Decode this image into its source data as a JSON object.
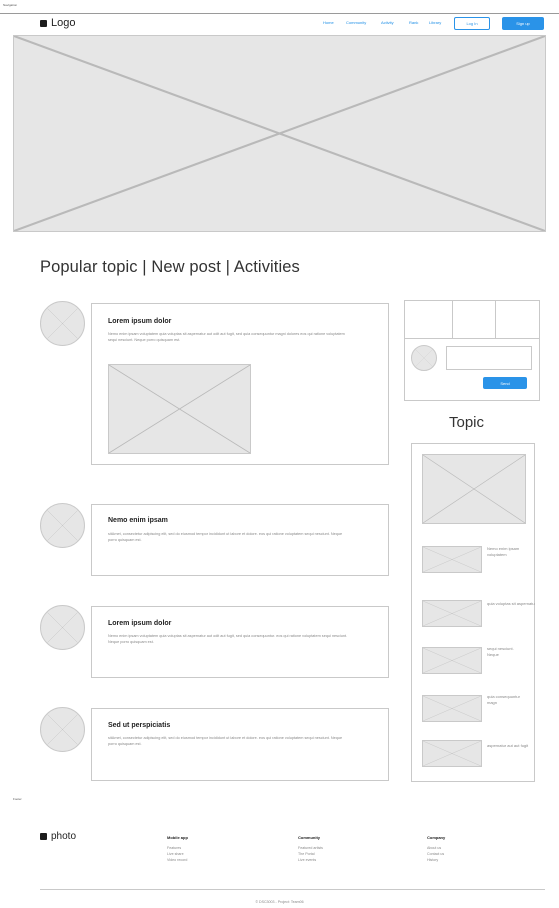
{
  "frame_labels": {
    "navigation": "Navigation",
    "footer": "Footer"
  },
  "header": {
    "logo": "Logo",
    "nav": [
      "Home",
      "Community",
      "Activity",
      "Rank",
      "Library"
    ],
    "login": "Log In",
    "signup": "Sign up"
  },
  "section_heading": "Popular topic  |  New post  |  Activities",
  "posts": [
    {
      "title": "Lorem ipsum dolor",
      "body": "Nemo enim ipsam voluptatem quia voluptas sit aspernatur aut odit aut fugit, sed quia consequuntur magni dolores eos qui ratione voluptatem sequi nesciunt. Neque porro quisquam est."
    },
    {
      "title": "Nemo enim ipsam",
      "body": "sitAmet, consectetur adipiscing elit, sed do eiusmod tempor incididunt ut labore et dolore. eos qui ratione voluptatem sequi nesciunt. Neque porro quisquam est."
    },
    {
      "title": "Lorem ipsum dolor",
      "body": "Nemo enim ipsam voluptatem quia voluptas sit aspernatur aut odit aut fugit, sed quia consequuntur. eos qui ratione voluptatem sequi nesciunt. Neque porro quisquam est."
    },
    {
      "title": "Sed ut perspiciatis",
      "body": "sitAmet, consectetur adipiscing elit, sed do eiusmod tempor incididunt ut labore et dolore. eos qui ratione voluptatem sequi nesciunt. Neque porro quisquam est."
    }
  ],
  "widget": {
    "send": "Send"
  },
  "topic": {
    "title": "Topic",
    "items": [
      "Nemo enim ipsam voluptatem",
      "quia voluptas sit aspernatu",
      "sequi nesciunt. Neque",
      "quia consequuntur magn",
      "aspernatur aut aut fugit"
    ]
  },
  "footer": {
    "logo": "photo",
    "columns": [
      {
        "title": "Mobile app",
        "items": [
          "Features",
          "Live share",
          "Video record"
        ]
      },
      {
        "title": "Community",
        "items": [
          "Featured artists",
          "The Portal",
          "Live events"
        ]
      },
      {
        "title": "Company",
        "items": [
          "About us",
          "Contact us",
          "History"
        ]
      }
    ],
    "copyright": "© DSC3003 - Project: Team06"
  },
  "colors": {
    "accent": "#2a93e8",
    "placeholder": "#e6e6e6",
    "border": "#c9c9c9"
  },
  "icons": {
    "logo": "logo-square-icon",
    "placeholder": "image-placeholder-icon"
  }
}
